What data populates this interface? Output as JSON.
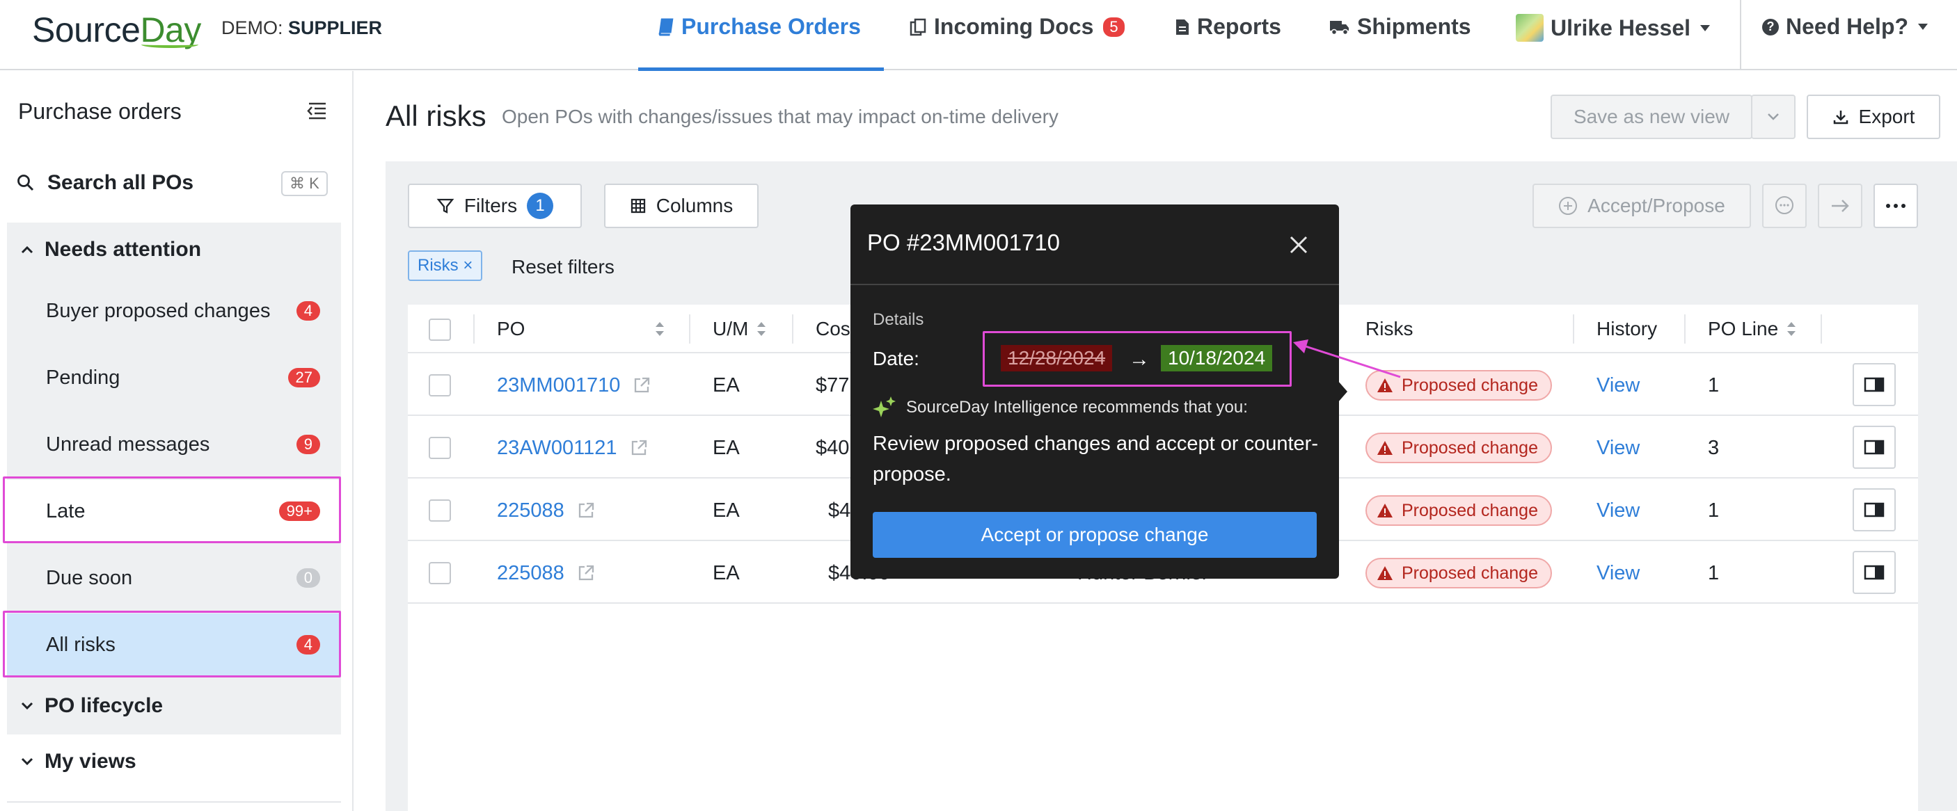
{
  "brand": {
    "name_part1": "Source",
    "name_part2": "Day",
    "demo_label": "DEMO:",
    "demo_role": "SUPPLIER"
  },
  "nav": {
    "purchase_orders": "Purchase Orders",
    "incoming_docs": "Incoming Docs",
    "incoming_docs_count": "5",
    "reports": "Reports",
    "shipments": "Shipments",
    "user_name": "Ulrike Hessel",
    "help": "Need Help?"
  },
  "sidebar": {
    "title": "Purchase orders",
    "search_label": "Search all POs",
    "search_shortcut": "⌘ K",
    "needs_attention": "Needs attention",
    "items": [
      {
        "label": "Buyer proposed changes",
        "count": "4"
      },
      {
        "label": "Pending",
        "count": "27"
      },
      {
        "label": "Unread messages",
        "count": "9"
      },
      {
        "label": "Late",
        "count": "99+"
      },
      {
        "label": "Due soon",
        "count": "0"
      },
      {
        "label": "All risks",
        "count": "4"
      }
    ],
    "po_lifecycle": "PO lifecycle",
    "my_views": "My views"
  },
  "main": {
    "title": "All risks",
    "subtitle": "Open POs with changes/issues that may impact on-time delivery",
    "save_view": "Save as new view",
    "export": "Export",
    "filters": "Filters",
    "filters_count": "1",
    "columns": "Columns",
    "accept_propose": "Accept/Propose",
    "risk_chip": "Risks",
    "reset_filters": "Reset filters"
  },
  "table": {
    "headers": {
      "po": "PO",
      "um": "U/M",
      "cost": "Cos",
      "risks": "Risks",
      "history": "History",
      "po_line": "PO Line"
    },
    "rows": [
      {
        "po": "23MM001710",
        "um": "EA",
        "cost": "$77",
        "risk": "Proposed change",
        "history": "View",
        "po_line": "1"
      },
      {
        "po": "23AW001121",
        "um": "EA",
        "cost": "$40",
        "risk": "Proposed change",
        "history": "View",
        "po_line": "3"
      },
      {
        "po": "225088",
        "um": "EA",
        "cost": "$4",
        "risk": "Proposed change",
        "history": "View",
        "po_line": "1"
      },
      {
        "po": "225088",
        "um": "EA",
        "cost": "$40.00",
        "buyer": "Hunter Bernier",
        "risk": "Proposed change",
        "history": "View",
        "po_line": "1"
      }
    ]
  },
  "popover": {
    "title": "PO #23MM001710",
    "details_label": "Details",
    "date_label": "Date:",
    "old_date": "12/28/2024",
    "new_date": "10/18/2024",
    "ai_text": "SourceDay Intelligence recommends that you:",
    "recommendation": "Review proposed changes and accept or counter-propose.",
    "button": "Accept or propose change"
  },
  "colors": {
    "accent": "#2f7ed8",
    "badge": "#e8403f",
    "highlight": "#e04bd6",
    "selected": "#cfe6fb"
  }
}
